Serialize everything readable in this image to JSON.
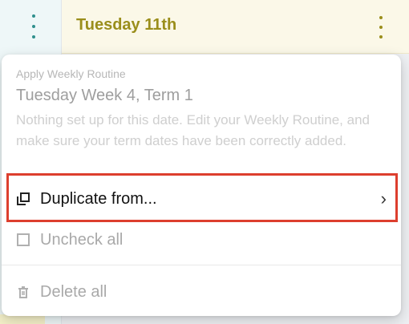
{
  "background": {
    "day_header_title": "Tuesday 11th"
  },
  "menu": {
    "section": {
      "small_label": "Apply Weekly Routine",
      "title": "Tuesday Week 4, Term 1",
      "description": "Nothing set up for this date. Edit your Weekly Routine, and make sure your term dates have been correctly added."
    },
    "items": [
      {
        "label": "Duplicate from...",
        "icon": "copy-icon",
        "has_submenu": true
      },
      {
        "label": "Uncheck all",
        "icon": "checkbox-icon",
        "has_submenu": false
      },
      {
        "label": "Delete all",
        "icon": "trash-icon",
        "has_submenu": false
      }
    ]
  },
  "colors": {
    "accent_teal": "#2f8f8d",
    "day_header_text": "#9a8e1b",
    "highlight_box": "#dd3f2e"
  }
}
